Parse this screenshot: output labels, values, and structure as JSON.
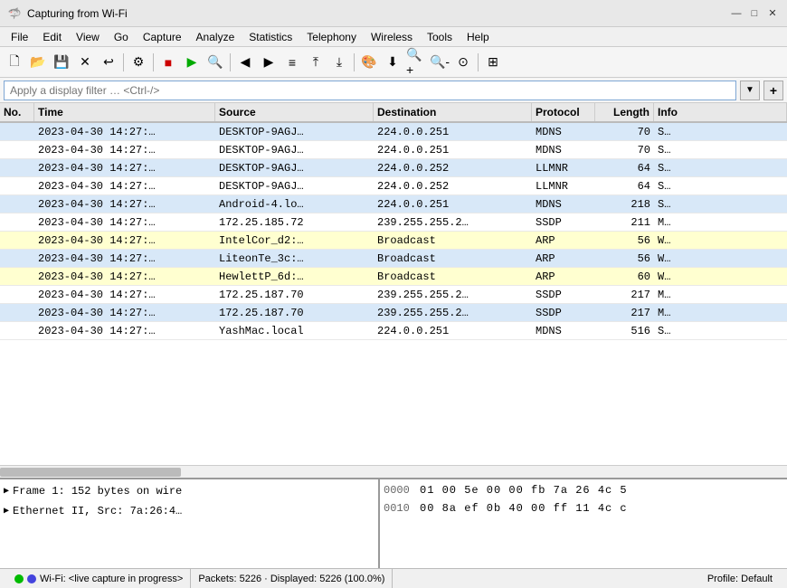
{
  "window": {
    "title": "Capturing from Wi-Fi",
    "icon": "🦈"
  },
  "titlebar": {
    "minimize": "—",
    "maximize": "□",
    "close": "✕"
  },
  "menu": {
    "items": [
      "File",
      "Edit",
      "View",
      "Go",
      "Capture",
      "Analyze",
      "Statistics",
      "Telephony",
      "Wireless",
      "Tools",
      "Help"
    ]
  },
  "filter": {
    "placeholder": "Apply a display filter … <Ctrl-/>"
  },
  "table": {
    "headers": [
      "No.",
      "Time",
      "Source",
      "Destination",
      "Protocol",
      "Length",
      "Info"
    ],
    "rows": [
      {
        "no": "",
        "time": "2023-04-30  14:27:…",
        "src": "DESKTOP-9AGJ…",
        "dst": "224.0.0.251",
        "proto": "MDNS",
        "len": "70",
        "info": "S…",
        "color": "row-blue"
      },
      {
        "no": "",
        "time": "2023-04-30  14:27:…",
        "src": "DESKTOP-9AGJ…",
        "dst": "224.0.0.251",
        "proto": "MDNS",
        "len": "70",
        "info": "S…",
        "color": "row-white"
      },
      {
        "no": "",
        "time": "2023-04-30  14:27:…",
        "src": "DESKTOP-9AGJ…",
        "dst": "224.0.0.252",
        "proto": "LLMNR",
        "len": "64",
        "info": "S…",
        "color": "row-blue"
      },
      {
        "no": "",
        "time": "2023-04-30  14:27:…",
        "src": "DESKTOP-9AGJ…",
        "dst": "224.0.0.252",
        "proto": "LLMNR",
        "len": "64",
        "info": "S…",
        "color": "row-white"
      },
      {
        "no": "",
        "time": "2023-04-30  14:27:…",
        "src": "Android-4.lo…",
        "dst": "224.0.0.251",
        "proto": "MDNS",
        "len": "218",
        "info": "S…",
        "color": "row-blue"
      },
      {
        "no": "",
        "time": "2023-04-30  14:27:…",
        "src": "172.25.185.72",
        "dst": "239.255.255.2…",
        "proto": "SSDP",
        "len": "211",
        "info": "M…",
        "color": "row-white"
      },
      {
        "no": "",
        "time": "2023-04-30  14:27:…",
        "src": "IntelCor_d2:…",
        "dst": "Broadcast",
        "proto": "ARP",
        "len": "56",
        "info": "W…",
        "color": "row-yellow"
      },
      {
        "no": "",
        "time": "2023-04-30  14:27:…",
        "src": "LiteonTe_3c:…",
        "dst": "Broadcast",
        "proto": "ARP",
        "len": "56",
        "info": "W…",
        "color": "row-blue"
      },
      {
        "no": "",
        "time": "2023-04-30  14:27:…",
        "src": "HewlettP_6d:…",
        "dst": "Broadcast",
        "proto": "ARP",
        "len": "60",
        "info": "W…",
        "color": "row-yellow"
      },
      {
        "no": "",
        "time": "2023-04-30  14:27:…",
        "src": "172.25.187.70",
        "dst": "239.255.255.2…",
        "proto": "SSDP",
        "len": "217",
        "info": "M…",
        "color": "row-white"
      },
      {
        "no": "",
        "time": "2023-04-30  14:27:…",
        "src": "172.25.187.70",
        "dst": "239.255.255.2…",
        "proto": "SSDP",
        "len": "217",
        "info": "M…",
        "color": "row-blue"
      },
      {
        "no": "",
        "time": "2023-04-30  14:27:…",
        "src": "YashMac.local",
        "dst": "224.0.0.251",
        "proto": "MDNS",
        "len": "516",
        "info": "S…",
        "color": "row-white"
      }
    ]
  },
  "bottom_left": {
    "rows": [
      {
        "arrow": "▶",
        "text": "Frame 1: 152 bytes on wire"
      },
      {
        "arrow": "▶",
        "text": "Ethernet II, Src: 7a:26:4…"
      }
    ]
  },
  "bottom_right": {
    "rows": [
      {
        "offset": "0000",
        "bytes": "01 00 5e 00 00 fb 7a 26   4c 5",
        "ascii": ""
      },
      {
        "offset": "0010",
        "bytes": "00 8a ef 0b 40 00 ff 11   4c c",
        "ascii": ""
      }
    ]
  },
  "status": {
    "wifi_label": "Wi-Fi: <live capture in progress>",
    "packets": "Packets: 5226 · Displayed: 5226 (100.0%)",
    "profile": "Profile: Default"
  }
}
